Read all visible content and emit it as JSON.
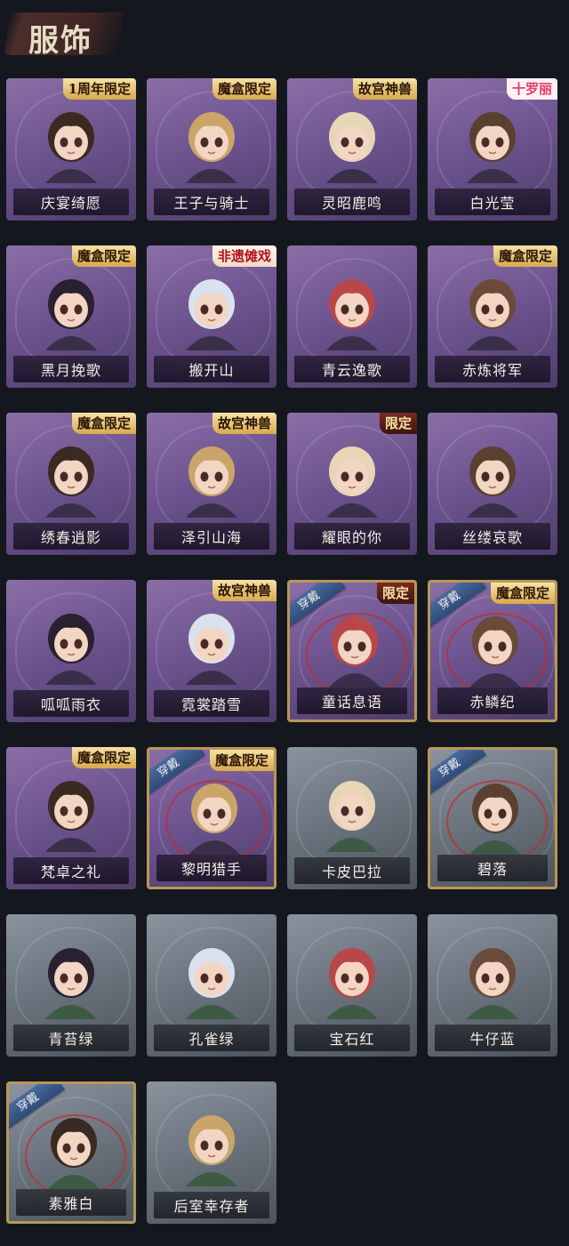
{
  "header": {
    "title": "服饰"
  },
  "colors": {
    "background": "#15171f",
    "card_purple": "#6f5591",
    "card_grey": "#6d7680",
    "equipped_border": "#b89757",
    "badge_gold": "#d8a94d"
  },
  "outfits": [
    {
      "name": "庆宴绮愿",
      "tier": "purple",
      "badge": "1周年限定",
      "badge_style": "gold",
      "equipped": false
    },
    {
      "name": "王子与骑士",
      "tier": "purple",
      "badge": "魔盒限定",
      "badge_style": "gold",
      "equipped": false
    },
    {
      "name": "灵昭鹿鸣",
      "tier": "purple",
      "badge": "故宫神兽",
      "badge_style": "gold",
      "equipped": false
    },
    {
      "name": "白光莹",
      "tier": "purple",
      "badge": "十罗丽",
      "badge_style": "pink",
      "equipped": false
    },
    {
      "name": "黑月挽歌",
      "tier": "purple",
      "badge": "魔盒限定",
      "badge_style": "gold",
      "equipped": false
    },
    {
      "name": "搬开山",
      "tier": "purple",
      "badge": "非遗傩戏",
      "badge_style": "red",
      "equipped": false
    },
    {
      "name": "青云逸歌",
      "tier": "purple",
      "badge": "",
      "badge_style": "",
      "equipped": false
    },
    {
      "name": "赤炼将军",
      "tier": "purple",
      "badge": "魔盒限定",
      "badge_style": "gold",
      "equipped": false
    },
    {
      "name": "绣春逍影",
      "tier": "purple",
      "badge": "魔盒限定",
      "badge_style": "gold",
      "equipped": false
    },
    {
      "name": "泽引山海",
      "tier": "purple",
      "badge": "故宫神兽",
      "badge_style": "gold",
      "equipped": false
    },
    {
      "name": "耀眼的你",
      "tier": "purple",
      "badge": "限定",
      "badge_style": "dark",
      "equipped": false
    },
    {
      "name": "丝缕哀歌",
      "tier": "purple",
      "badge": "",
      "badge_style": "",
      "equipped": false
    },
    {
      "name": "呱呱雨衣",
      "tier": "purple",
      "badge": "",
      "badge_style": "",
      "equipped": false
    },
    {
      "name": "霓裳踏雪",
      "tier": "purple",
      "badge": "故宫神兽",
      "badge_style": "gold",
      "equipped": false
    },
    {
      "name": "童话息语",
      "tier": "purple",
      "badge": "限定",
      "badge_style": "dark",
      "equipped": true
    },
    {
      "name": "赤鳞纪",
      "tier": "purple",
      "badge": "魔盒限定",
      "badge_style": "gold",
      "equipped": true
    },
    {
      "name": "梵卓之礼",
      "tier": "purple",
      "badge": "魔盒限定",
      "badge_style": "gold",
      "equipped": false
    },
    {
      "name": "黎明猎手",
      "tier": "purple",
      "badge": "魔盒限定",
      "badge_style": "gold",
      "equipped": true
    },
    {
      "name": "卡皮巴拉",
      "tier": "grey",
      "badge": "",
      "badge_style": "",
      "equipped": false
    },
    {
      "name": "碧落",
      "tier": "grey",
      "badge": "",
      "badge_style": "",
      "equipped": true
    },
    {
      "name": "青苔绿",
      "tier": "grey",
      "badge": "",
      "badge_style": "",
      "equipped": false
    },
    {
      "name": "孔雀绿",
      "tier": "grey",
      "badge": "",
      "badge_style": "",
      "equipped": false
    },
    {
      "name": "宝石红",
      "tier": "grey",
      "badge": "",
      "badge_style": "",
      "equipped": false
    },
    {
      "name": "牛仔蓝",
      "tier": "grey",
      "badge": "",
      "badge_style": "",
      "equipped": false
    },
    {
      "name": "素雅白",
      "tier": "grey",
      "badge": "",
      "badge_style": "",
      "equipped": true
    },
    {
      "name": "后室幸存者",
      "tier": "grey",
      "badge": "",
      "badge_style": "",
      "equipped": false
    }
  ],
  "equipped_label": "穿戴"
}
